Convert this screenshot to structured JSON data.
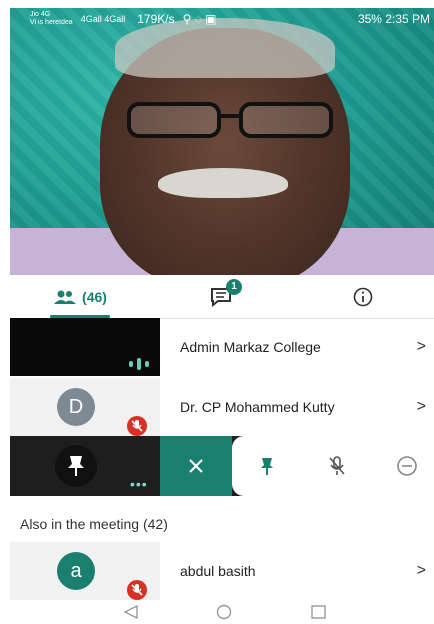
{
  "status_bar": {
    "carrier_line1": "Jio 4G",
    "carrier_line2": "Vi is hereIdea",
    "signal": "4Gall 4Gall",
    "speed": "179K/s",
    "right": "35%  2:35 PM"
  },
  "tabs": {
    "people_count": "(46)",
    "chat_badge": "1"
  },
  "participants": [
    {
      "name": "Admin Markaz College"
    },
    {
      "name": "Dr. CP Mohammed Kutty",
      "initial": "D"
    }
  ],
  "section_title": "Also in the meeting (42)",
  "others": [
    {
      "name": "abdul basith",
      "initial": "a"
    }
  ],
  "colors": {
    "accent": "#1a7f6f",
    "muted_red": "#d93025"
  },
  "icons": [
    "people-icon",
    "chat-icon",
    "info-icon",
    "pin-icon",
    "close-icon",
    "mic-off-icon",
    "remove-icon",
    "chevron-right-icon"
  ]
}
